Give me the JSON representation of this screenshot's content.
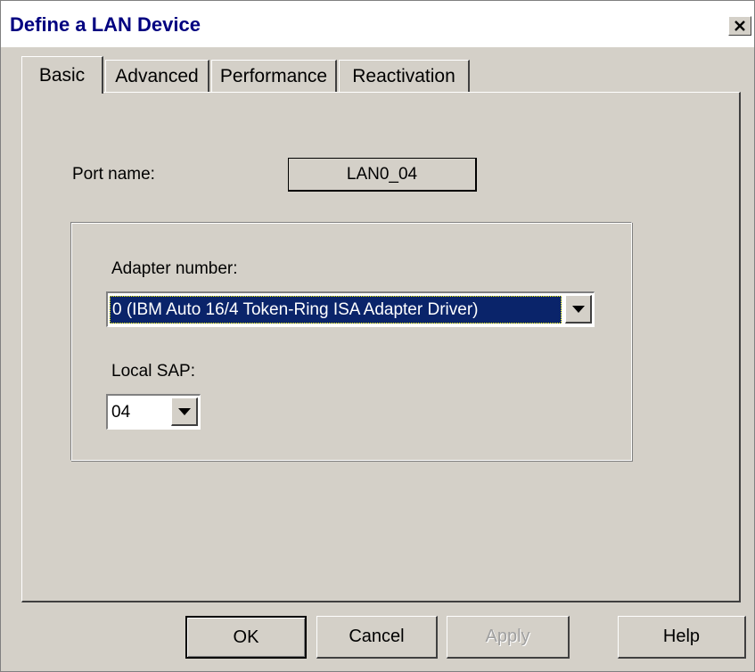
{
  "window": {
    "title": "Define a LAN Device",
    "close_icon": "close-icon"
  },
  "tabs": [
    {
      "label": "Basic",
      "active": true
    },
    {
      "label": "Advanced",
      "active": false
    },
    {
      "label": "Performance",
      "active": false
    },
    {
      "label": "Reactivation",
      "active": false
    }
  ],
  "basic": {
    "port_label": "Port name:",
    "port_value": "LAN0_04",
    "adapter_label": "Adapter number:",
    "adapter_value": "0 (IBM Auto 16/4 Token-Ring ISA Adapter Driver)",
    "sap_label": "Local SAP:",
    "sap_value": "04"
  },
  "buttons": {
    "ok": "OK",
    "cancel": "Cancel",
    "apply": "Apply",
    "help": "Help"
  },
  "colors": {
    "selection": "#0a246a",
    "title_text": "#000080",
    "face": "#d4d0c8"
  }
}
